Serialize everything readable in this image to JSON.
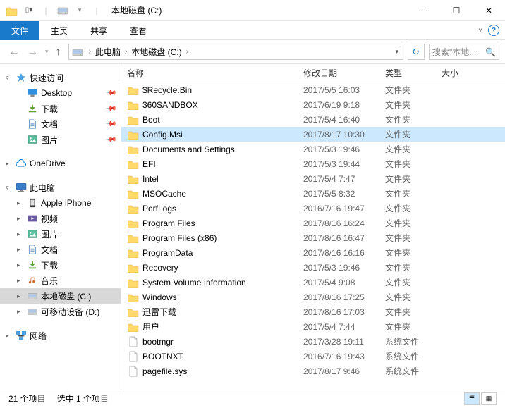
{
  "titlebar": {
    "title": "本地磁盘 (C:)"
  },
  "ribbon": {
    "file": "文件",
    "tabs": [
      "主页",
      "共享",
      "查看"
    ]
  },
  "nav": {
    "crumbs": [
      "此电脑",
      "本地磁盘 (C:)"
    ],
    "search_placeholder": "搜索\"本地..."
  },
  "sidebar": {
    "quickaccess": {
      "label": "快速访问",
      "items": [
        {
          "label": "Desktop",
          "pin": true,
          "icon": "desktop"
        },
        {
          "label": "下载",
          "pin": true,
          "icon": "downloads"
        },
        {
          "label": "文档",
          "pin": true,
          "icon": "documents"
        },
        {
          "label": "图片",
          "pin": true,
          "icon": "pictures"
        }
      ]
    },
    "onedrive": {
      "label": "OneDrive"
    },
    "thispc": {
      "label": "此电脑",
      "items": [
        {
          "label": "Apple iPhone",
          "icon": "phone"
        },
        {
          "label": "视频",
          "icon": "videos"
        },
        {
          "label": "图片",
          "icon": "pictures"
        },
        {
          "label": "文档",
          "icon": "documents"
        },
        {
          "label": "下载",
          "icon": "downloads"
        },
        {
          "label": "音乐",
          "icon": "music"
        },
        {
          "label": "本地磁盘 (C:)",
          "icon": "drive",
          "selected": true
        },
        {
          "label": "可移动设备 (D:)",
          "icon": "drive"
        }
      ]
    },
    "network": {
      "label": "网络"
    }
  },
  "columns": {
    "name": "名称",
    "date": "修改日期",
    "type": "类型",
    "size": "大小"
  },
  "files": [
    {
      "name": "$Recycle.Bin",
      "date": "2017/5/5 16:03",
      "type": "文件夹",
      "icon": "folder"
    },
    {
      "name": "360SANDBOX",
      "date": "2017/6/19 9:18",
      "type": "文件夹",
      "icon": "folder"
    },
    {
      "name": "Boot",
      "date": "2017/5/4 16:40",
      "type": "文件夹",
      "icon": "folder"
    },
    {
      "name": "Config.Msi",
      "date": "2017/8/17 10:30",
      "type": "文件夹",
      "icon": "folder",
      "selected": true
    },
    {
      "name": "Documents and Settings",
      "date": "2017/5/3 19:46",
      "type": "文件夹",
      "icon": "folder"
    },
    {
      "name": "EFI",
      "date": "2017/5/3 19:44",
      "type": "文件夹",
      "icon": "folder"
    },
    {
      "name": "Intel",
      "date": "2017/5/4 7:47",
      "type": "文件夹",
      "icon": "folder"
    },
    {
      "name": "MSOCache",
      "date": "2017/5/5 8:32",
      "type": "文件夹",
      "icon": "folder"
    },
    {
      "name": "PerfLogs",
      "date": "2016/7/16 19:47",
      "type": "文件夹",
      "icon": "folder"
    },
    {
      "name": "Program Files",
      "date": "2017/8/16 16:24",
      "type": "文件夹",
      "icon": "folder"
    },
    {
      "name": "Program Files (x86)",
      "date": "2017/8/16 16:47",
      "type": "文件夹",
      "icon": "folder"
    },
    {
      "name": "ProgramData",
      "date": "2017/8/16 16:16",
      "type": "文件夹",
      "icon": "folder"
    },
    {
      "name": "Recovery",
      "date": "2017/5/3 19:46",
      "type": "文件夹",
      "icon": "folder"
    },
    {
      "name": "System Volume Information",
      "date": "2017/5/4 9:08",
      "type": "文件夹",
      "icon": "folder"
    },
    {
      "name": "Windows",
      "date": "2017/8/16 17:25",
      "type": "文件夹",
      "icon": "folder"
    },
    {
      "name": "迅雷下载",
      "date": "2017/8/16 17:03",
      "type": "文件夹",
      "icon": "folder"
    },
    {
      "name": "用户",
      "date": "2017/5/4 7:44",
      "type": "文件夹",
      "icon": "folder"
    },
    {
      "name": "bootmgr",
      "date": "2017/3/28 19:11",
      "type": "系统文件",
      "icon": "file"
    },
    {
      "name": "BOOTNXT",
      "date": "2016/7/16 19:43",
      "type": "系统文件",
      "icon": "file"
    },
    {
      "name": "pagefile.sys",
      "date": "2017/8/17 9:46",
      "type": "系统文件",
      "icon": "file"
    }
  ],
  "status": {
    "count": "21 个项目",
    "selected": "选中 1 个项目"
  }
}
